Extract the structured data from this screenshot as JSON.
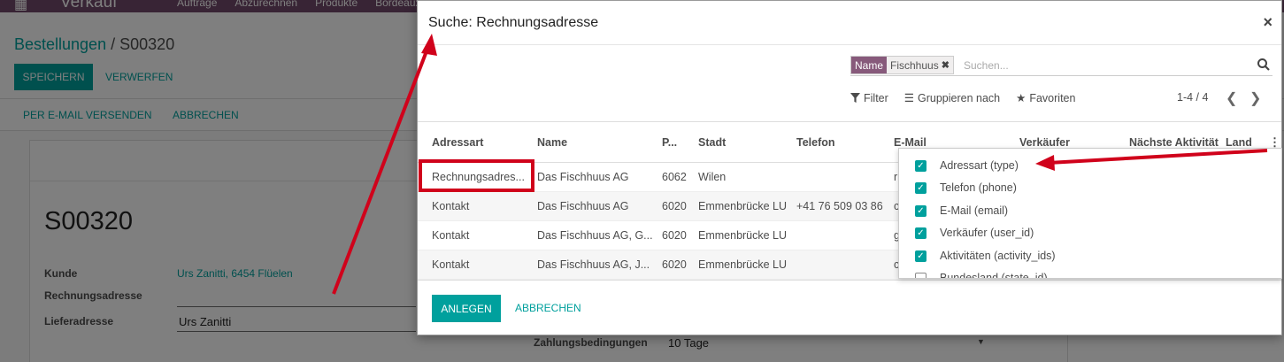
{
  "topbar": {
    "app_name": "Verkauf",
    "menu": [
      "Aufträge",
      "Abzurechnen",
      "Produkte",
      "Bordeaux"
    ]
  },
  "breadcrumb": {
    "parent": "Bestellungen",
    "separator": "/",
    "current": "S00320"
  },
  "toolbar": {
    "save_label": "SPEICHERN",
    "discard_label": "VERWERFEN"
  },
  "statusbar": {
    "send_email_label": "PER E-MAIL VERSENDEN",
    "cancel_label": "ABBRECHEN"
  },
  "form": {
    "order_name": "S00320",
    "customer_label": "Kunde",
    "customer_value": "Urs Zanitti, 6454 Flüelen",
    "invoice_address_label": "Rechnungsadresse",
    "delivery_address_label": "Lieferadresse",
    "delivery_address_value": "Urs Zanitti",
    "payment_terms_label": "Zahlungsbedingungen",
    "payment_terms_value": "10 Tage"
  },
  "modal": {
    "title": "Suche: Rechnungsadresse",
    "search": {
      "facet_category": "Name",
      "facet_value": "Fischhuus",
      "placeholder": "Suchen..."
    },
    "filters": {
      "filter_label": "Filter",
      "group_by_label": "Gruppieren nach",
      "favorites_label": "Favoriten"
    },
    "pager": "1-4 / 4",
    "columns": [
      "Adressart",
      "Name",
      "P...",
      "Stadt",
      "Telefon",
      "E-Mail",
      "Verkäufer",
      "Nächste Aktivität",
      "Land"
    ],
    "rows": [
      {
        "type": "Rechnungsadres...",
        "name": "Das Fischhuus AG",
        "zip": "6062",
        "city": "Wilen",
        "phone": "",
        "email": "r"
      },
      {
        "type": "Kontakt",
        "name": "Das Fischhuus AG",
        "zip": "6020",
        "city": "Emmenbrücke LU",
        "phone": "+41 76 509 03 86",
        "email": "c"
      },
      {
        "type": "Kontakt",
        "name": "Das Fischhuus AG, G...",
        "zip": "6020",
        "city": "Emmenbrücke LU",
        "phone": "",
        "email": "g"
      },
      {
        "type": "Kontakt",
        "name": "Das Fischhuus AG, J...",
        "zip": "6020",
        "city": "Emmenbrücke LU",
        "phone": "",
        "email": "c"
      }
    ],
    "optional_columns": [
      {
        "label": "Adressart (type)",
        "checked": true
      },
      {
        "label": "Telefon (phone)",
        "checked": true
      },
      {
        "label": "E-Mail (email)",
        "checked": true
      },
      {
        "label": "Verkäufer (user_id)",
        "checked": true
      },
      {
        "label": "Aktivitäten (activity_ids)",
        "checked": true
      },
      {
        "label": "Bundesland (state_id)",
        "checked": false
      }
    ],
    "footer": {
      "create_label": "ANLEGEN",
      "cancel_label": "ABBRECHEN"
    }
  },
  "colors": {
    "primary": "#00a09d",
    "brand": "#71496a",
    "facet": "#875a7b",
    "annotation": "#d0021b"
  }
}
